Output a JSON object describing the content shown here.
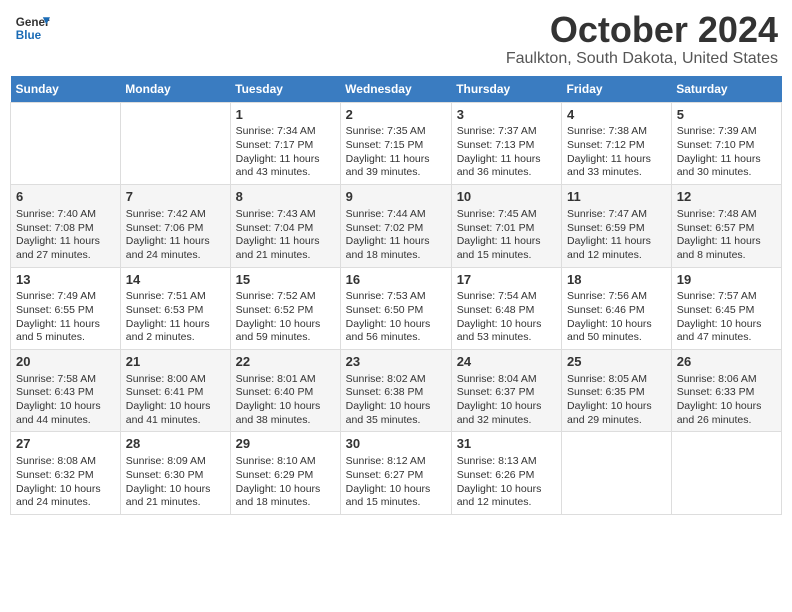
{
  "header": {
    "logo_text_general": "General",
    "logo_text_blue": "Blue",
    "month_title": "October 2024",
    "location": "Faulkton, South Dakota, United States"
  },
  "weekdays": [
    "Sunday",
    "Monday",
    "Tuesday",
    "Wednesday",
    "Thursday",
    "Friday",
    "Saturday"
  ],
  "weeks": [
    [
      {
        "day": "",
        "info": ""
      },
      {
        "day": "",
        "info": ""
      },
      {
        "day": "1",
        "info": "Sunrise: 7:34 AM\nSunset: 7:17 PM\nDaylight: 11 hours and 43 minutes."
      },
      {
        "day": "2",
        "info": "Sunrise: 7:35 AM\nSunset: 7:15 PM\nDaylight: 11 hours and 39 minutes."
      },
      {
        "day": "3",
        "info": "Sunrise: 7:37 AM\nSunset: 7:13 PM\nDaylight: 11 hours and 36 minutes."
      },
      {
        "day": "4",
        "info": "Sunrise: 7:38 AM\nSunset: 7:12 PM\nDaylight: 11 hours and 33 minutes."
      },
      {
        "day": "5",
        "info": "Sunrise: 7:39 AM\nSunset: 7:10 PM\nDaylight: 11 hours and 30 minutes."
      }
    ],
    [
      {
        "day": "6",
        "info": "Sunrise: 7:40 AM\nSunset: 7:08 PM\nDaylight: 11 hours and 27 minutes."
      },
      {
        "day": "7",
        "info": "Sunrise: 7:42 AM\nSunset: 7:06 PM\nDaylight: 11 hours and 24 minutes."
      },
      {
        "day": "8",
        "info": "Sunrise: 7:43 AM\nSunset: 7:04 PM\nDaylight: 11 hours and 21 minutes."
      },
      {
        "day": "9",
        "info": "Sunrise: 7:44 AM\nSunset: 7:02 PM\nDaylight: 11 hours and 18 minutes."
      },
      {
        "day": "10",
        "info": "Sunrise: 7:45 AM\nSunset: 7:01 PM\nDaylight: 11 hours and 15 minutes."
      },
      {
        "day": "11",
        "info": "Sunrise: 7:47 AM\nSunset: 6:59 PM\nDaylight: 11 hours and 12 minutes."
      },
      {
        "day": "12",
        "info": "Sunrise: 7:48 AM\nSunset: 6:57 PM\nDaylight: 11 hours and 8 minutes."
      }
    ],
    [
      {
        "day": "13",
        "info": "Sunrise: 7:49 AM\nSunset: 6:55 PM\nDaylight: 11 hours and 5 minutes."
      },
      {
        "day": "14",
        "info": "Sunrise: 7:51 AM\nSunset: 6:53 PM\nDaylight: 11 hours and 2 minutes."
      },
      {
        "day": "15",
        "info": "Sunrise: 7:52 AM\nSunset: 6:52 PM\nDaylight: 10 hours and 59 minutes."
      },
      {
        "day": "16",
        "info": "Sunrise: 7:53 AM\nSunset: 6:50 PM\nDaylight: 10 hours and 56 minutes."
      },
      {
        "day": "17",
        "info": "Sunrise: 7:54 AM\nSunset: 6:48 PM\nDaylight: 10 hours and 53 minutes."
      },
      {
        "day": "18",
        "info": "Sunrise: 7:56 AM\nSunset: 6:46 PM\nDaylight: 10 hours and 50 minutes."
      },
      {
        "day": "19",
        "info": "Sunrise: 7:57 AM\nSunset: 6:45 PM\nDaylight: 10 hours and 47 minutes."
      }
    ],
    [
      {
        "day": "20",
        "info": "Sunrise: 7:58 AM\nSunset: 6:43 PM\nDaylight: 10 hours and 44 minutes."
      },
      {
        "day": "21",
        "info": "Sunrise: 8:00 AM\nSunset: 6:41 PM\nDaylight: 10 hours and 41 minutes."
      },
      {
        "day": "22",
        "info": "Sunrise: 8:01 AM\nSunset: 6:40 PM\nDaylight: 10 hours and 38 minutes."
      },
      {
        "day": "23",
        "info": "Sunrise: 8:02 AM\nSunset: 6:38 PM\nDaylight: 10 hours and 35 minutes."
      },
      {
        "day": "24",
        "info": "Sunrise: 8:04 AM\nSunset: 6:37 PM\nDaylight: 10 hours and 32 minutes."
      },
      {
        "day": "25",
        "info": "Sunrise: 8:05 AM\nSunset: 6:35 PM\nDaylight: 10 hours and 29 minutes."
      },
      {
        "day": "26",
        "info": "Sunrise: 8:06 AM\nSunset: 6:33 PM\nDaylight: 10 hours and 26 minutes."
      }
    ],
    [
      {
        "day": "27",
        "info": "Sunrise: 8:08 AM\nSunset: 6:32 PM\nDaylight: 10 hours and 24 minutes."
      },
      {
        "day": "28",
        "info": "Sunrise: 8:09 AM\nSunset: 6:30 PM\nDaylight: 10 hours and 21 minutes."
      },
      {
        "day": "29",
        "info": "Sunrise: 8:10 AM\nSunset: 6:29 PM\nDaylight: 10 hours and 18 minutes."
      },
      {
        "day": "30",
        "info": "Sunrise: 8:12 AM\nSunset: 6:27 PM\nDaylight: 10 hours and 15 minutes."
      },
      {
        "day": "31",
        "info": "Sunrise: 8:13 AM\nSunset: 6:26 PM\nDaylight: 10 hours and 12 minutes."
      },
      {
        "day": "",
        "info": ""
      },
      {
        "day": "",
        "info": ""
      }
    ]
  ]
}
